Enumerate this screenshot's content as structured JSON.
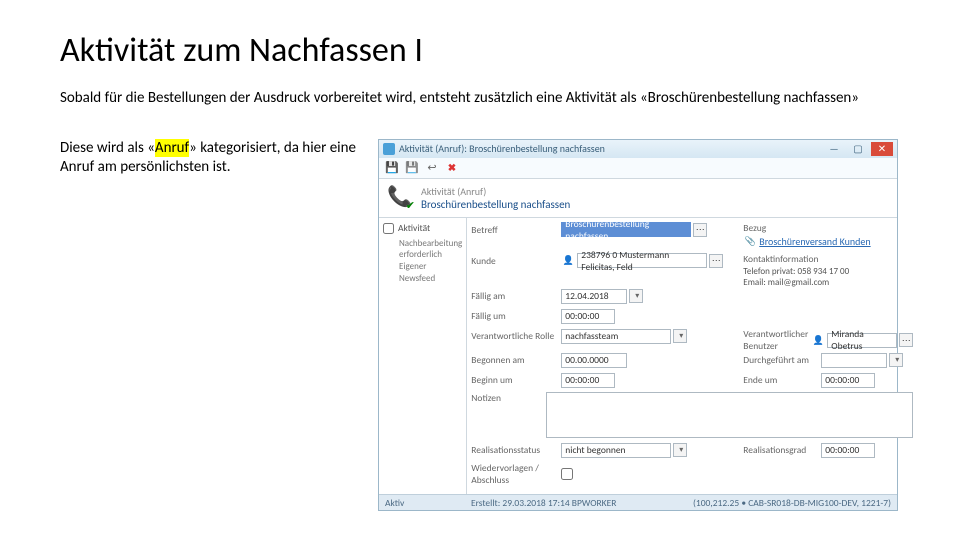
{
  "slide": {
    "title": "Aktivität zum Nachfassen I",
    "intro": "Sobald für die Bestellungen der Ausdruck vorbereitet wird, entsteht zusätzlich eine Aktivität als «Broschürenbestellung nachfassen»",
    "note_pre": "Diese wird als «",
    "note_hl": "Anruf",
    "note_post": "» kategorisiert, da hier eine Anruf am persönlichsten ist."
  },
  "crm": {
    "titlebar": "Aktivität (Anruf): Broschürenbestellung nachfassen",
    "winbtns": {
      "min": "—",
      "max": "▢",
      "close": "✕"
    },
    "header": {
      "line1": "Aktivität (Anruf)",
      "line2": "Broschürenbestellung nachfassen"
    },
    "toolbar": {
      "del": "✖"
    },
    "side": {
      "chk": "Aktivität",
      "sub": "Nachbearbeitung erforderlich\nEigener Newsfeed"
    },
    "labels": {
      "betreff": "Betreff",
      "bezug": "Bezug",
      "kunde": "Kunde",
      "kontaktinfo": "Kontaktinformation",
      "faellig_am": "Fällig am",
      "faellig_um": "Fällig um",
      "rolle": "Verantwortliche Rolle",
      "benutzer": "Verantwortlicher Benutzer",
      "begonnen_am": "Begonnen am",
      "durchgef": "Durchgeführt am",
      "beginn_um": "Beginn um",
      "ende_um": "Ende um",
      "notizen": "Notizen",
      "realstatus": "Realisationsstatus",
      "realgrad": "Realisationsgrad",
      "wiedervorlagen": "Wiedervorlagen / Abschluss"
    },
    "values": {
      "betreff": "Broschürenbestellung nachfassen",
      "bezug": "Broschürenversand Kunden",
      "kunde": "238796 0 Mustermann Felicitas, Feld",
      "kontaktinfo": "Telefon privat: 058 934 17 00\nEmail: mail@gmail.com",
      "faellig_am": "12.04.2018",
      "faellig_um": "00:00:00",
      "rolle": "nachfassteam",
      "benutzer": "Miranda Obetrus",
      "begonnen_am": "00.00.0000",
      "beginn_um": "00:00:00",
      "ende_um": "00:00:00",
      "realstatus": "nicht begonnen",
      "realgrad": "00:00:00"
    },
    "status": {
      "left": "Aktiv",
      "mid": "Erstellt: 29.03.2018 17:14  BPWORKER",
      "right": "(100,212.25 • CAB-SR018-DB-MIG100-DEV, 1221-7)"
    }
  }
}
